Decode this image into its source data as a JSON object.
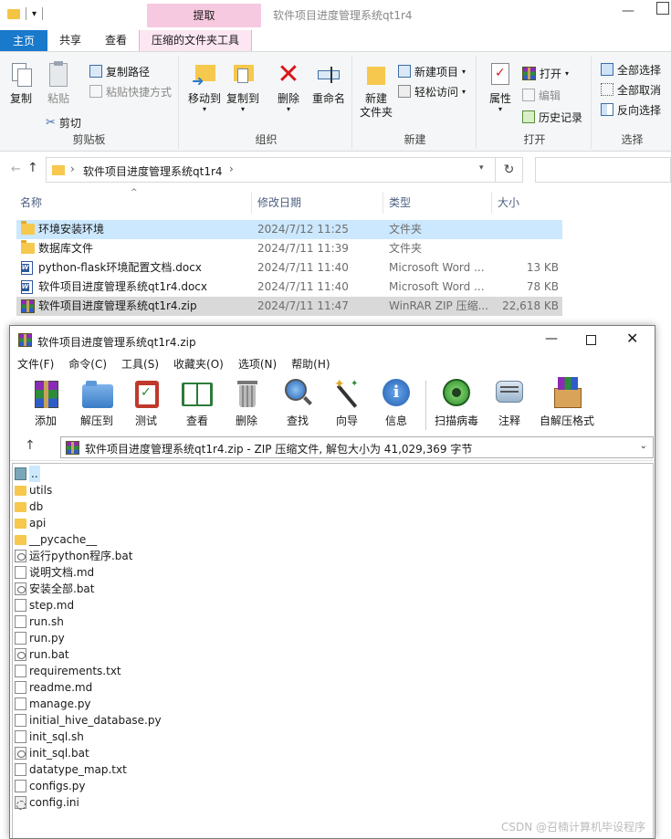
{
  "explorer": {
    "context_tab_group": "提取",
    "window_title": "软件项目进度管理系统qt1r4",
    "tabs": [
      "主页",
      "共享",
      "查看",
      "压缩的文件夹工具"
    ],
    "ribbon": {
      "clipboard": {
        "label": "剪贴板",
        "copy": "复制",
        "paste": "粘贴",
        "copy_path": "复制路径",
        "paste_shortcut": "粘贴快捷方式",
        "cut": "剪切"
      },
      "organize": {
        "label": "组织",
        "move_to": "移动到",
        "copy_to": "复制到",
        "delete": "删除",
        "rename": "重命名"
      },
      "new": {
        "label": "新建",
        "new_folder_line1": "新建",
        "new_folder_line2": "文件夹",
        "new_item": "新建项目",
        "easy_access": "轻松访问"
      },
      "open": {
        "label": "打开",
        "properties": "属性",
        "open": "打开",
        "edit": "编辑",
        "history": "历史记录"
      },
      "select": {
        "label": "选择",
        "select_all": "全部选择",
        "select_none": "全部取消",
        "invert": "反向选择"
      }
    },
    "address": {
      "crumb": "软件项目进度管理系统qt1r4",
      "separator": "›"
    },
    "columns": {
      "name": "名称",
      "modified": "修改日期",
      "type": "类型",
      "size": "大小"
    },
    "files": [
      {
        "name": "环境安装环境",
        "modified": "2024/7/12 11:25",
        "type": "文件夹",
        "size": "",
        "icon": "folder-icon"
      },
      {
        "name": "数据库文件",
        "modified": "2024/7/11 11:39",
        "type": "文件夹",
        "size": "",
        "icon": "folder-icon"
      },
      {
        "name": "python-flask环境配置文档.docx",
        "modified": "2024/7/11 11:40",
        "type": "Microsoft Word ...",
        "size": "13 KB",
        "icon": "word-icon"
      },
      {
        "name": "软件项目进度管理系统qt1r4.docx",
        "modified": "2024/7/11 11:40",
        "type": "Microsoft Word ...",
        "size": "78 KB",
        "icon": "word-icon"
      },
      {
        "name": "软件项目进度管理系统qt1r4.zip",
        "modified": "2024/7/11 11:47",
        "type": "WinRAR ZIP 压缩...",
        "size": "22,618 KB",
        "icon": "winrar-icon"
      }
    ]
  },
  "winrar": {
    "title": "软件项目进度管理系统qt1r4.zip",
    "menu": [
      "文件(F)",
      "命令(C)",
      "工具(S)",
      "收藏夹(O)",
      "选项(N)",
      "帮助(H)"
    ],
    "tools": [
      "添加",
      "解压到",
      "测试",
      "查看",
      "删除",
      "查找",
      "向导",
      "信息",
      "扫描病毒",
      "注释",
      "自解压格式"
    ],
    "path": "软件项目进度管理系统qt1r4.zip - ZIP 压缩文件, 解包大小为 41,029,369 字节",
    "entries": [
      {
        "name": "..",
        "icon": "up"
      },
      {
        "name": "utils",
        "icon": "folder"
      },
      {
        "name": "db",
        "icon": "folder"
      },
      {
        "name": "api",
        "icon": "folder"
      },
      {
        "name": "__pycache__",
        "icon": "folder"
      },
      {
        "name": "运行python程序.bat",
        "icon": "bat"
      },
      {
        "name": "说明文档.md",
        "icon": "file"
      },
      {
        "name": "安装全部.bat",
        "icon": "bat"
      },
      {
        "name": "step.md",
        "icon": "file"
      },
      {
        "name": "run.sh",
        "icon": "file"
      },
      {
        "name": "run.py",
        "icon": "file"
      },
      {
        "name": "run.bat",
        "icon": "bat"
      },
      {
        "name": "requirements.txt",
        "icon": "file"
      },
      {
        "name": "readme.md",
        "icon": "file"
      },
      {
        "name": "manage.py",
        "icon": "file"
      },
      {
        "name": "initial_hive_database.py",
        "icon": "file"
      },
      {
        "name": "init_sql.sh",
        "icon": "file"
      },
      {
        "name": "init_sql.bat",
        "icon": "bat"
      },
      {
        "name": "datatype_map.txt",
        "icon": "file"
      },
      {
        "name": "configs.py",
        "icon": "file"
      },
      {
        "name": "config.ini",
        "icon": "ini"
      }
    ]
  },
  "watermark": "CSDN @召楠计算机毕设程序",
  "colors": {
    "accent": "#1979ca",
    "context_tab": "#f7c9e0",
    "selection": "#cce8ff",
    "folder": "#f6c84d"
  }
}
